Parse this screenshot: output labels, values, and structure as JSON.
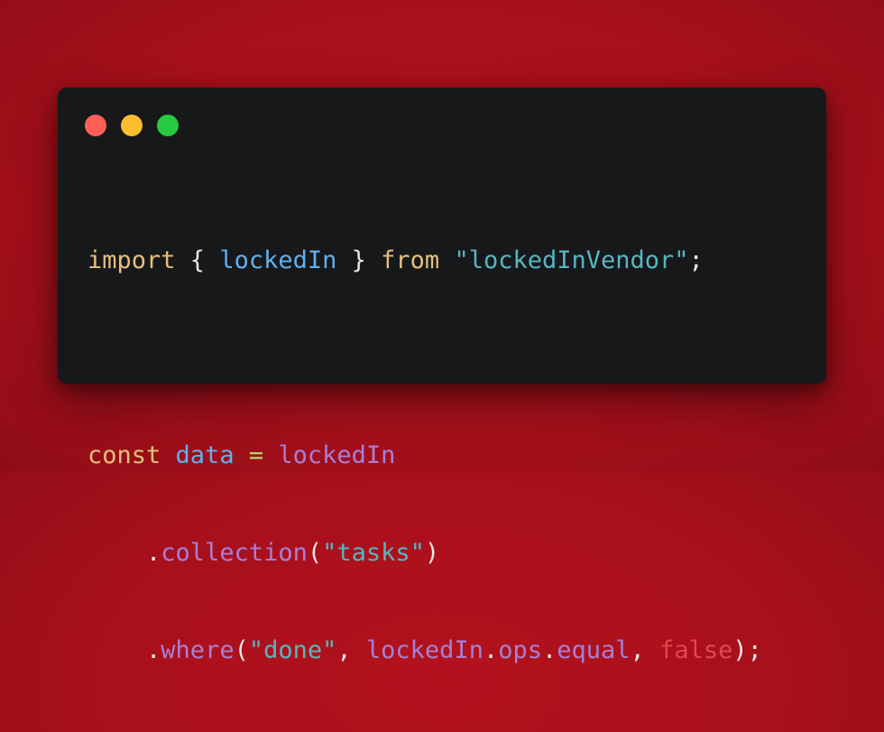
{
  "colors": {
    "background": "#a5111b",
    "window": "#17181a",
    "dot_close": "#ff5f57",
    "dot_minimize": "#febc2e",
    "dot_maximize": "#28c840",
    "keyword": "#e5c07b",
    "identifier": "#61afef",
    "string": "#56b6c2",
    "method": "#a77fd6",
    "operator": "#b6d46b",
    "boolean": "#e0484d",
    "punctuation": "#e6e6e6"
  },
  "window_controls": [
    "close",
    "minimize",
    "maximize"
  ],
  "code": {
    "line1": {
      "import_kw": "import",
      "brace_open": " { ",
      "name": "lockedIn",
      "brace_close": " } ",
      "from_kw": "from",
      "space": " ",
      "module": "\"lockedInVendor\"",
      "semi": ";"
    },
    "line3": {
      "const_kw": "const",
      "space1": " ",
      "var": "data",
      "space2": " ",
      "eq": "=",
      "space3": " ",
      "obj": "lockedIn"
    },
    "line4": {
      "indent": "    ",
      "dot": ".",
      "method": "collection",
      "paren_open": "(",
      "arg": "\"tasks\"",
      "paren_close": ")"
    },
    "line5": {
      "indent": "    ",
      "dot": ".",
      "method": "where",
      "paren_open": "(",
      "arg1": "\"done\"",
      "comma1": ", ",
      "obj": "lockedIn",
      "dot2": ".",
      "prop": "ops",
      "dot3": ".",
      "member": "equal",
      "comma2": ", ",
      "bool": "false",
      "paren_close": ");"
    }
  }
}
